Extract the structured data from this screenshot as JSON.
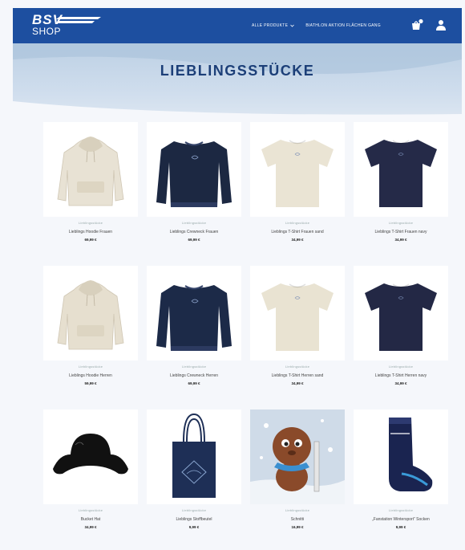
{
  "header": {
    "logo_top": "BSV",
    "logo_bottom": "SHOP",
    "nav": [
      {
        "label": "ALLE PRODUKTE"
      },
      {
        "label": "BIATHLON AKTION FLÄCHEN GANG"
      }
    ]
  },
  "hero": {
    "title": "LIEBLINGSSTÜCKE"
  },
  "products": [
    {
      "category": "Lieblingsstücke",
      "name": "Lieblings Hoodie Frauen",
      "price": "69,99 €",
      "type": "hoodie",
      "color": "#e8e2d4"
    },
    {
      "category": "Lieblingsstücke",
      "name": "Lieblings Crewneck Frauen",
      "price": "69,99 €",
      "type": "crew",
      "color": "#1c2842"
    },
    {
      "category": "Lieblingsstücke",
      "name": "Lieblings T-Shirt Frauen sand",
      "price": "34,99 €",
      "type": "tee",
      "color": "#eae4d4"
    },
    {
      "category": "Lieblingsstücke",
      "name": "Lieblings T-Shirt Frauen navy",
      "price": "34,99 €",
      "type": "tee",
      "color": "#252a48"
    },
    {
      "category": "Lieblingsstücke",
      "name": "Lieblings Hoodie Herren",
      "price": "59,99 €",
      "type": "hoodie",
      "color": "#e6dfcf"
    },
    {
      "category": "Lieblingsstücke",
      "name": "Lieblings Crewneck Herren",
      "price": "69,99 €",
      "type": "crew",
      "color": "#1c2a48"
    },
    {
      "category": "Lieblingsstücke",
      "name": "Lieblings T-Shirt Herren sand",
      "price": "34,99 €",
      "type": "tee",
      "color": "#e9e3d2"
    },
    {
      "category": "Lieblingsstücke",
      "name": "Lieblings T-Shirt Herren navy",
      "price": "34,99 €",
      "type": "tee",
      "color": "#232845"
    },
    {
      "category": "Lieblingsstücke",
      "name": "Bucket Hat",
      "price": "34,99 €",
      "type": "hat",
      "color": "#111111"
    },
    {
      "category": "Lieblingsstücke",
      "name": "Lieblings Stoffbeutel",
      "price": "9,99 €",
      "type": "bag",
      "color": "#1e2f56"
    },
    {
      "category": "Lieblingsstücke",
      "name": "Schnitti",
      "price": "16,99 €",
      "type": "mascot",
      "color": "#8a4a2a"
    },
    {
      "category": "Lieblingsstücke",
      "name": "„Fanstation Wintersport“ Socken",
      "price": "9,99 €",
      "type": "sock",
      "color": "#1a2450"
    }
  ],
  "colors": {
    "brand_blue": "#1d4fa0",
    "title_navy": "#1c3f78"
  }
}
